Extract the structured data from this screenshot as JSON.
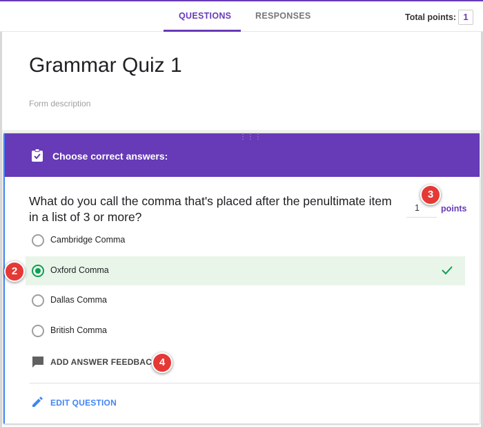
{
  "tabs": [
    {
      "label": "QUESTIONS",
      "active": true
    },
    {
      "label": "RESPONSES",
      "active": false
    }
  ],
  "total_points": {
    "label": "Total points:",
    "value": "1"
  },
  "form": {
    "title": "Grammar Quiz 1",
    "description_placeholder": "Form description"
  },
  "question_card": {
    "header": "Choose correct answers:",
    "question": "What do you call the comma that's placed after the penultimate item in a list of 3 or more?",
    "points_value": "1",
    "points_label": "points",
    "options": [
      {
        "label": "Cambridge Comma",
        "selected": false
      },
      {
        "label": "Oxford Comma",
        "selected": true,
        "correct": true
      },
      {
        "label": "Dallas Comma",
        "selected": false
      },
      {
        "label": "British Comma",
        "selected": false
      }
    ],
    "feedback_label": "ADD ANSWER FEEDBACK",
    "edit_label": "EDIT QUESTION"
  },
  "callouts": [
    "2",
    "3",
    "4"
  ],
  "colors": {
    "accent": "#673ab7",
    "correct_green": "#0f9d58",
    "correct_bg": "#e9f5e9",
    "link_blue": "#4285f4",
    "callout_red": "#e53935"
  },
  "icons": [
    "clipboard-check-icon",
    "check-icon",
    "comment-icon",
    "pencil-icon",
    "drag-handle-icon"
  ]
}
